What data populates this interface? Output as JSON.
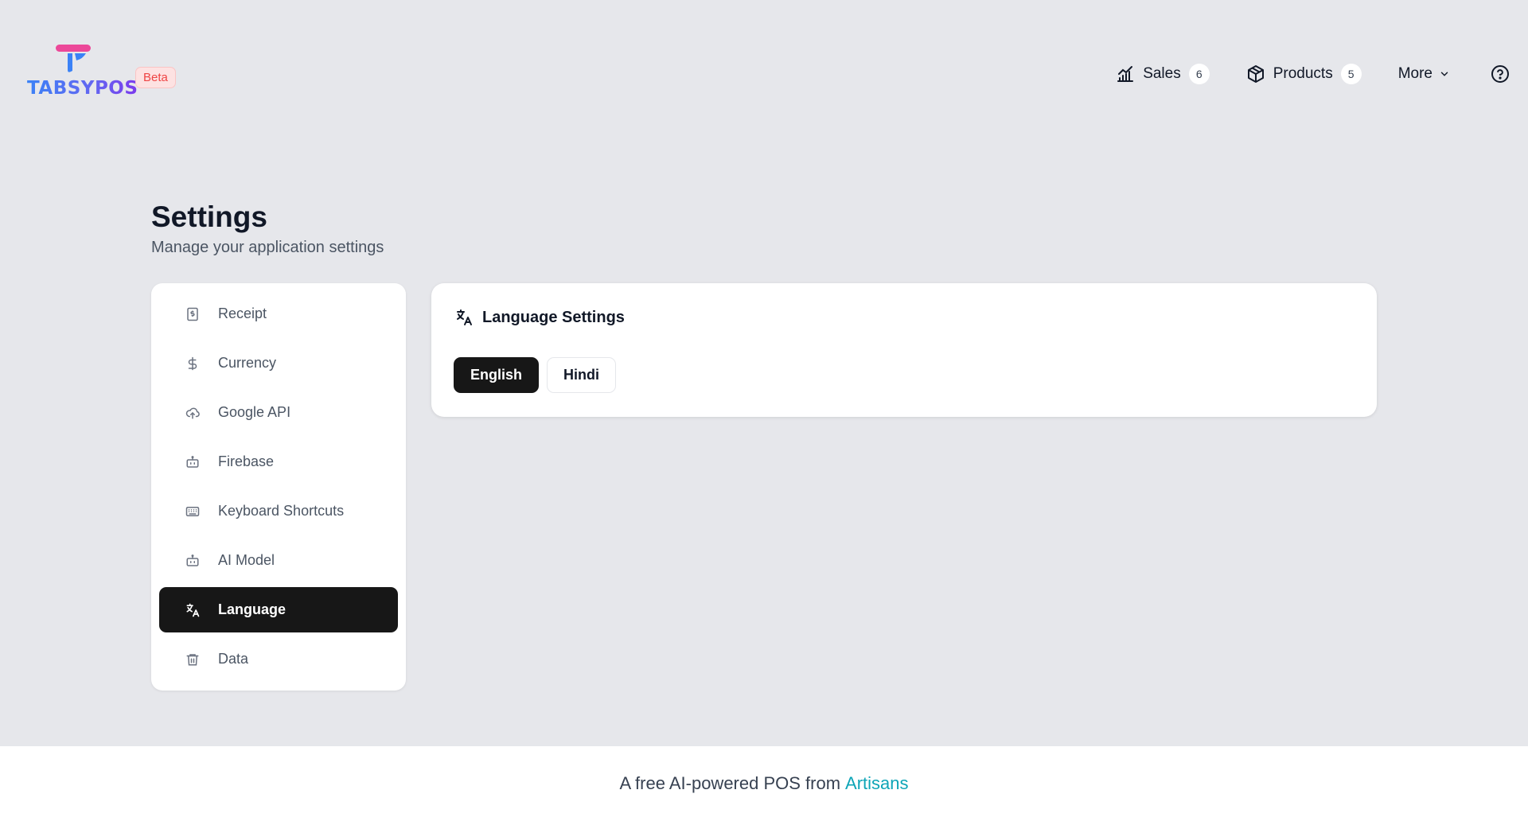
{
  "brand": {
    "name": "TABSYPOS",
    "badge": "Beta",
    "colors": {
      "primary": "#3b82f6",
      "accent": "#ec4899",
      "badge": "#ef4444"
    }
  },
  "nav": {
    "items": [
      {
        "label": "Sales",
        "icon": "chart-icon",
        "count": "6"
      },
      {
        "label": "Products",
        "icon": "box-icon",
        "count": "5"
      },
      {
        "label": "More",
        "icon": "chevron-down-icon"
      }
    ],
    "help_icon": "help-circle-icon"
  },
  "page": {
    "title": "Settings",
    "subtitle": "Manage your application settings"
  },
  "sidebar": {
    "items": [
      {
        "label": "Receipt",
        "icon": "receipt-icon"
      },
      {
        "label": "Currency",
        "icon": "dollar-icon"
      },
      {
        "label": "Google API",
        "icon": "cloud-upload-icon"
      },
      {
        "label": "Firebase",
        "icon": "bot-icon"
      },
      {
        "label": "Keyboard Shortcuts",
        "icon": "keyboard-icon"
      },
      {
        "label": "AI Model",
        "icon": "bot-icon"
      },
      {
        "label": "Language",
        "icon": "translate-icon",
        "active": true
      },
      {
        "label": "Data",
        "icon": "trash-icon"
      }
    ]
  },
  "language_card": {
    "title": "Language Settings",
    "options": [
      {
        "label": "English",
        "selected": true
      },
      {
        "label": "Hindi",
        "selected": false
      }
    ]
  },
  "footer": {
    "text": "A free AI-powered POS from",
    "link": "Artisans",
    "link_color": "#0ea5b7"
  }
}
